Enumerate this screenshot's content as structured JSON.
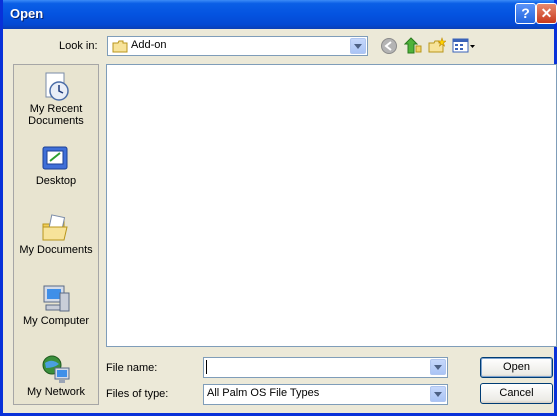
{
  "window": {
    "title": "Open",
    "help_glyph": "?",
    "close_glyph": "✕"
  },
  "toolbar": {
    "look_in_label": "Look in:",
    "look_in_value": "Add-on",
    "icons": [
      "back-icon",
      "up-folder-icon",
      "new-folder-icon",
      "view-menu-icon"
    ]
  },
  "places": [
    {
      "label": "My Recent Documents",
      "icon": "recent-documents-icon"
    },
    {
      "label": "Desktop",
      "icon": "desktop-icon"
    },
    {
      "label": "My Documents",
      "icon": "my-documents-icon"
    },
    {
      "label": "My Computer",
      "icon": "my-computer-icon"
    },
    {
      "label": "My Network",
      "icon": "my-network-icon"
    }
  ],
  "form": {
    "file_name_label": "File name:",
    "file_name_value": "",
    "files_of_type_label": "Files of type:",
    "files_of_type_value": "All Palm OS File Types"
  },
  "buttons": {
    "open": "Open",
    "cancel": "Cancel"
  },
  "colors": {
    "title_bar": "#0453e0",
    "window_bg": "#ece9d8",
    "border": "#0831d9"
  }
}
